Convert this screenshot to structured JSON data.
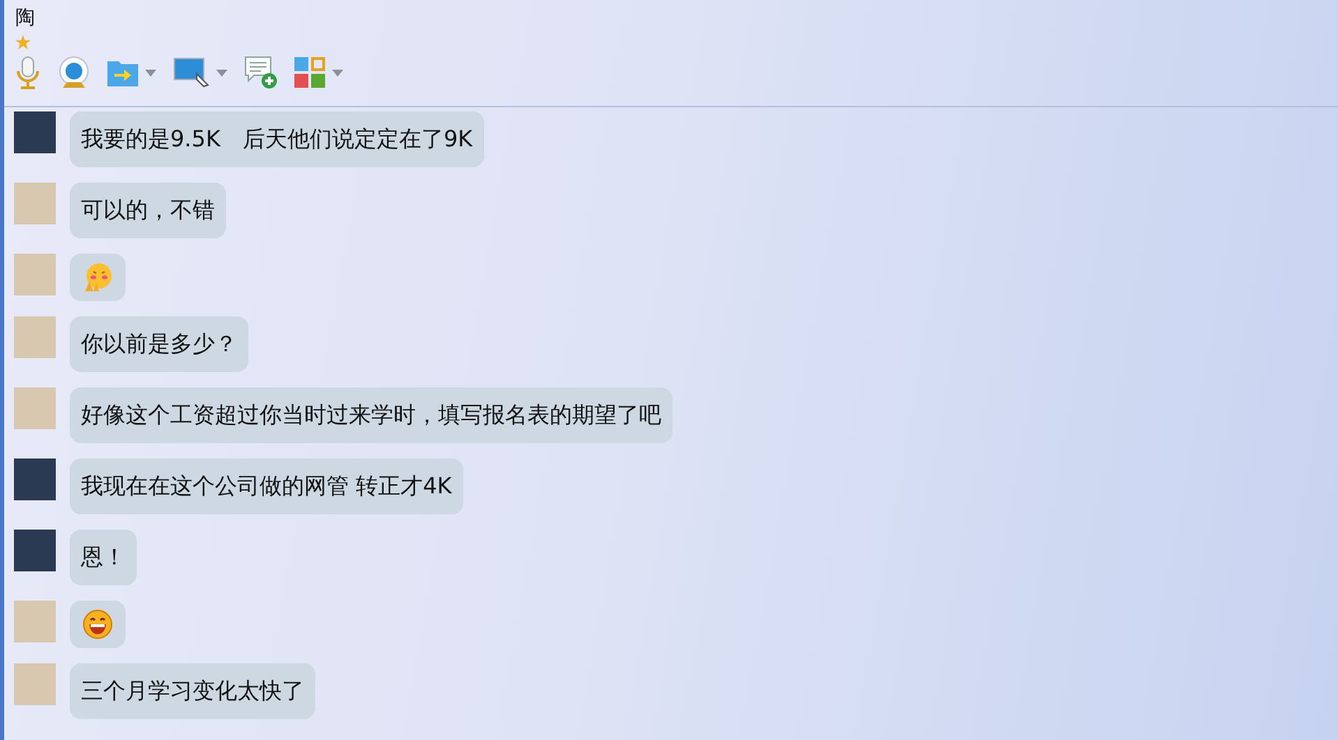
{
  "window": {
    "title": "陶"
  },
  "toolbar": [
    {
      "kind": "mic",
      "dropdown": false
    },
    {
      "kind": "camera",
      "dropdown": false
    },
    {
      "kind": "folder",
      "dropdown": true
    },
    {
      "kind": "screen",
      "dropdown": true
    },
    {
      "kind": "chat",
      "dropdown": false
    },
    {
      "kind": "apps",
      "dropdown": true
    }
  ],
  "messages": [
    {
      "color": "#2a3a52",
      "kind": "text",
      "text": "我要的是9.5K　后天他们说定定在了9K"
    },
    {
      "color": "#d8c8b0",
      "kind": "text",
      "text": "可以的，不错"
    },
    {
      "color": "#d8c8b0",
      "kind": "shy"
    },
    {
      "color": "#d8c8b0",
      "kind": "text",
      "text": "你以前是多少？"
    },
    {
      "color": "#d8c8b0",
      "kind": "text",
      "text": "好像这个工资超过你当时过来学时，填写报名表的期望了吧"
    },
    {
      "color": "#2a3a52",
      "kind": "text",
      "text": "我现在在这个公司做的网管 转正才4K"
    },
    {
      "color": "#2a3a52",
      "kind": "text",
      "text": "恩！"
    },
    {
      "color": "#d8c8b0",
      "kind": "laugh"
    },
    {
      "color": "#d8c8b0",
      "kind": "text",
      "text": "三个月学习变化太快了"
    }
  ]
}
